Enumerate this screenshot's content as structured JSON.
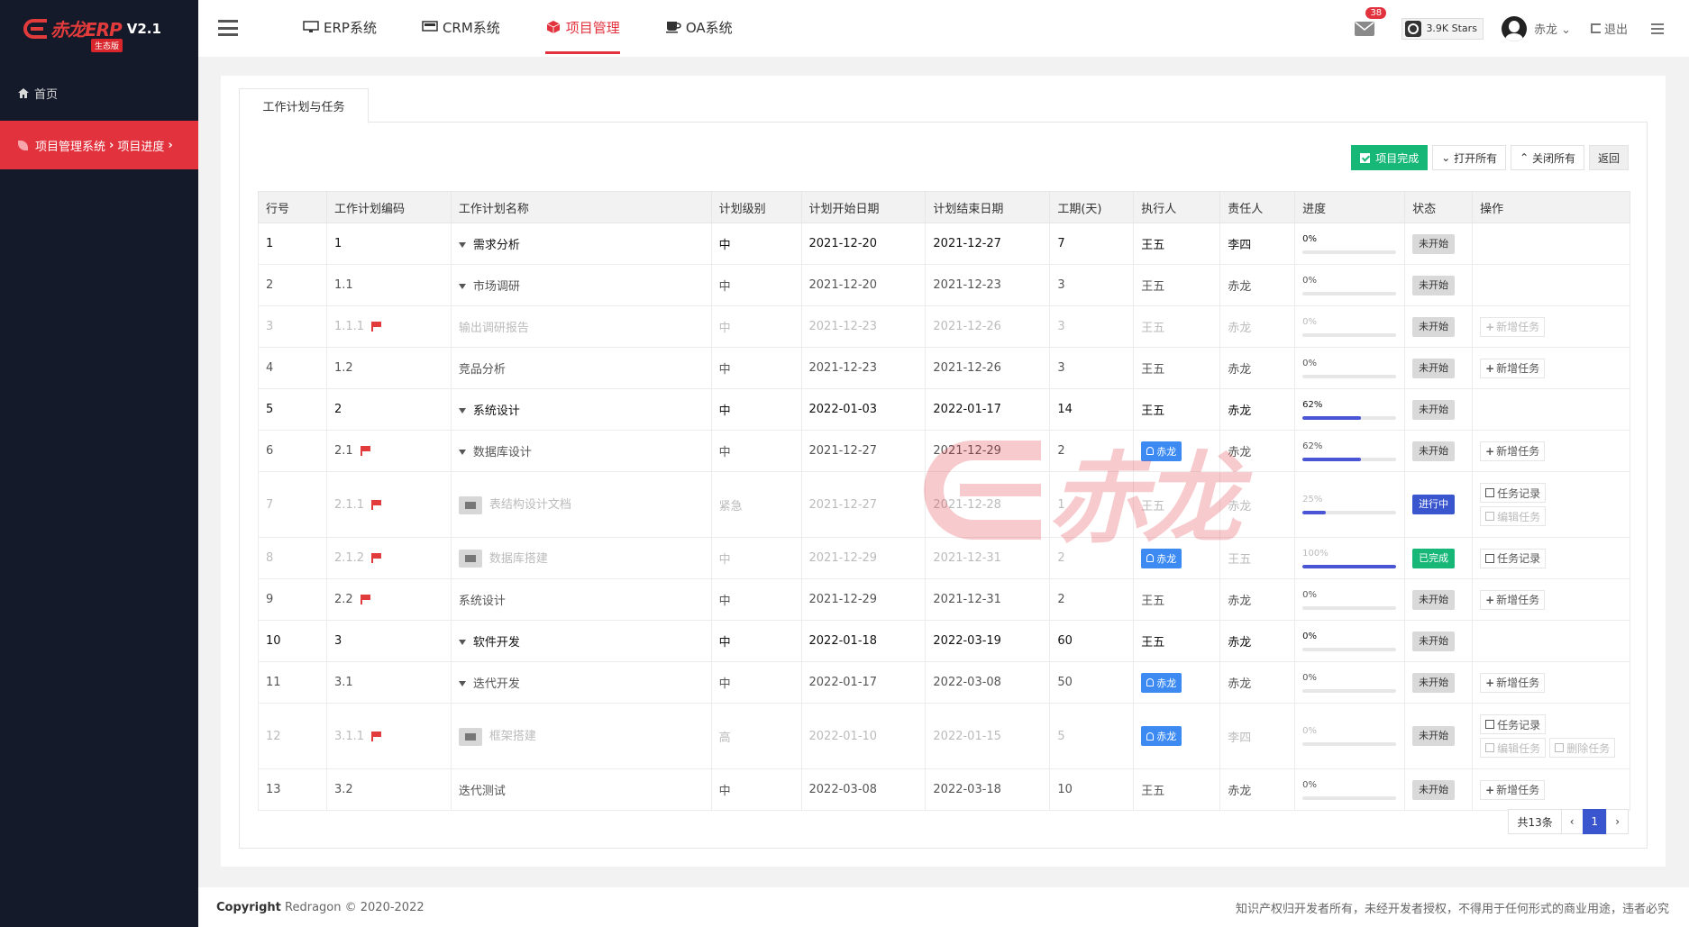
{
  "app": {
    "logo_text": "赤龙ERP",
    "version": "V2.1",
    "edition": "生态版"
  },
  "sidebar": {
    "home": "首页",
    "active_parent": "项目管理系统",
    "active_child": "项目进度"
  },
  "topnav": {
    "items": [
      {
        "label": "ERP系统",
        "icon": "erp-icon"
      },
      {
        "label": "CRM系统",
        "icon": "crm-icon"
      },
      {
        "label": "项目管理",
        "icon": "cube-icon",
        "active": true
      },
      {
        "label": "OA系统",
        "icon": "coffee-icon"
      }
    ],
    "mail_count": "38",
    "stars": "3.9K Stars",
    "user": "赤龙",
    "logout": "退出"
  },
  "tab": {
    "label": "工作计划与任务"
  },
  "toolbar": {
    "complete": "项目完成",
    "open_all": "打开所有",
    "close_all": "关闭所有",
    "back": "返回"
  },
  "table": {
    "headers": [
      "行号",
      "工作计划编码",
      "工作计划名称",
      "计划级别",
      "计划开始日期",
      "计划结束日期",
      "工期(天)",
      "执行人",
      "责任人",
      "进度",
      "状态",
      "操作"
    ],
    "rows": [
      {
        "no": "1",
        "code": "1",
        "name": "需求分析",
        "level": "中",
        "start": "2021-12-20",
        "end": "2021-12-27",
        "days": "7",
        "exec": "王五",
        "owner": "李四",
        "progress": "0%",
        "status": "未开始"
      },
      {
        "no": "2",
        "code": "1.1",
        "name": "市场调研",
        "level": "中",
        "start": "2021-12-20",
        "end": "2021-12-23",
        "days": "3",
        "exec": "王五",
        "owner": "赤龙",
        "progress": "0%",
        "status": "未开始"
      },
      {
        "no": "3",
        "code": "1.1.1",
        "name": "输出调研报告",
        "level": "中",
        "start": "2021-12-23",
        "end": "2021-12-26",
        "days": "3",
        "exec": "王五",
        "owner": "赤龙",
        "progress": "0%",
        "status": "未开始",
        "act1": "新增任务"
      },
      {
        "no": "4",
        "code": "1.2",
        "name": "竞品分析",
        "level": "中",
        "start": "2021-12-23",
        "end": "2021-12-26",
        "days": "3",
        "exec": "王五",
        "owner": "赤龙",
        "progress": "0%",
        "status": "未开始",
        "act1": "新增任务"
      },
      {
        "no": "5",
        "code": "2",
        "name": "系统设计",
        "level": "中",
        "start": "2022-01-03",
        "end": "2022-01-17",
        "days": "14",
        "exec": "王五",
        "owner": "赤龙",
        "progress": "62%",
        "status": "未开始"
      },
      {
        "no": "6",
        "code": "2.1",
        "name": "数据库设计",
        "level": "中",
        "start": "2021-12-27",
        "end": "2021-12-29",
        "days": "2",
        "exec": "赤龙",
        "owner": "赤龙",
        "progress": "62%",
        "status": "未开始",
        "act1": "新增任务"
      },
      {
        "no": "7",
        "code": "2.1.1",
        "name": "表结构设计文档",
        "level": "紧急",
        "start": "2021-12-27",
        "end": "2021-12-28",
        "days": "1",
        "exec": "王五",
        "owner": "赤龙",
        "progress": "25%",
        "status": "进行中",
        "act1": "任务记录",
        "act2": "编辑任务"
      },
      {
        "no": "8",
        "code": "2.1.2",
        "name": "数据库搭建",
        "level": "中",
        "start": "2021-12-29",
        "end": "2021-12-31",
        "days": "2",
        "exec": "赤龙",
        "owner": "王五",
        "progress": "100%",
        "status": "已完成",
        "act1": "任务记录"
      },
      {
        "no": "9",
        "code": "2.2",
        "name": "系统设计",
        "level": "中",
        "start": "2021-12-29",
        "end": "2021-12-31",
        "days": "2",
        "exec": "王五",
        "owner": "赤龙",
        "progress": "0%",
        "status": "未开始",
        "act1": "新增任务"
      },
      {
        "no": "10",
        "code": "3",
        "name": "软件开发",
        "level": "中",
        "start": "2022-01-18",
        "end": "2022-03-19",
        "days": "60",
        "exec": "王五",
        "owner": "赤龙",
        "progress": "0%",
        "status": "未开始"
      },
      {
        "no": "11",
        "code": "3.1",
        "name": "迭代开发",
        "level": "中",
        "start": "2022-01-17",
        "end": "2022-03-08",
        "days": "50",
        "exec": "赤龙",
        "owner": "赤龙",
        "progress": "0%",
        "status": "未开始",
        "act1": "新增任务"
      },
      {
        "no": "12",
        "code": "3.1.1",
        "name": "框架搭建",
        "level": "高",
        "start": "2022-01-10",
        "end": "2022-01-15",
        "days": "5",
        "exec": "赤龙",
        "owner": "李四",
        "progress": "0%",
        "status": "未开始",
        "act1": "任务记录",
        "act2": "编辑任务",
        "act3": "删除任务"
      },
      {
        "no": "13",
        "code": "3.2",
        "name": "迭代测试",
        "level": "中",
        "start": "2022-03-08",
        "end": "2022-03-18",
        "days": "10",
        "exec": "王五",
        "owner": "赤龙",
        "progress": "0%",
        "status": "未开始",
        "act1": "新增任务"
      }
    ]
  },
  "pager": {
    "total": "共13条",
    "prev": "‹",
    "current": "1",
    "next": "›"
  },
  "watermark": "赤龙",
  "footer": {
    "copyright_label": "Copyright",
    "copyright_text": "Redragon © 2020-2022",
    "notice": "知识产权归开发者所有，未经开发者授权，不得用于任何形式的商业用途，违者必究"
  },
  "colors": {
    "accent": "#e2323d",
    "sidebar": "#141a2a",
    "success": "#16b777",
    "primary": "#3a56cf",
    "person": "#3d8bf2"
  }
}
